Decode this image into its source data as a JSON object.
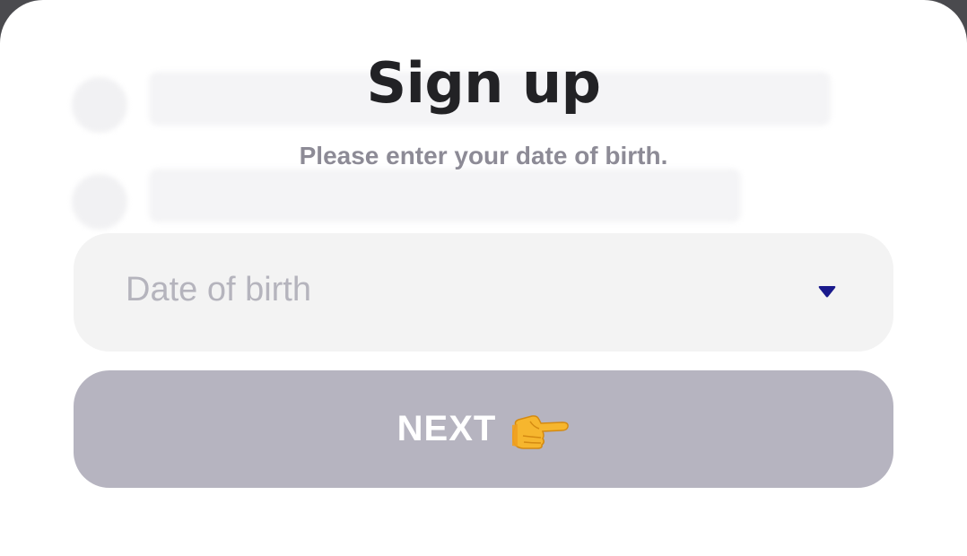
{
  "signup": {
    "title": "Sign up",
    "subtitle": "Please enter your date of birth.",
    "dob_placeholder": "Date of birth",
    "next_label": "NEXT"
  },
  "icons": {
    "dropdown": "caret-down-icon",
    "next": "pointing-right-hand-icon"
  },
  "colors": {
    "caret": "#1a1a8c",
    "button_bg": "#b4b2be",
    "field_bg": "#f2f2f3",
    "title": "#222225",
    "subtitle": "#8d8b96"
  }
}
